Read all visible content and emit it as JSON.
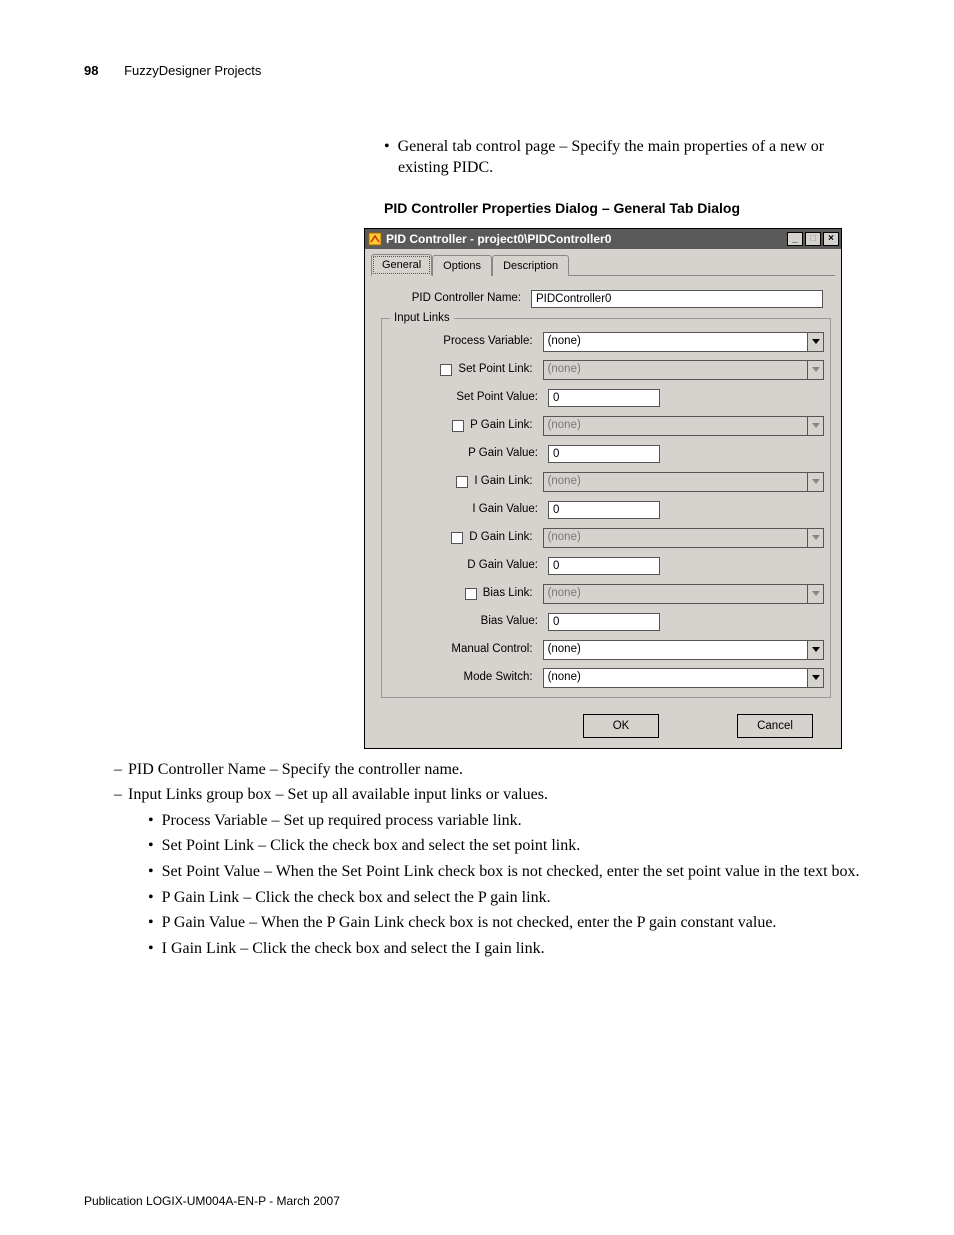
{
  "header": {
    "page_number": "98",
    "chapter": "FuzzyDesigner Projects"
  },
  "intro": "General tab control page – Specify the main properties of a new or existing PIDC.",
  "figure_caption": "PID Controller Properties Dialog – General Tab Dialog",
  "dialog": {
    "title": "PID Controller - project0\\PIDController0",
    "tabs": [
      "General",
      "Options",
      "Description"
    ],
    "name_label": "PID Controller Name:",
    "name_value": "PIDController0",
    "group_title": "Input Links",
    "rows": [
      {
        "label": "Process Variable:",
        "type": "combo",
        "value": "(none)",
        "checkbox": false,
        "enabled": true
      },
      {
        "label": "Set Point Link:",
        "type": "combo",
        "value": "(none)",
        "checkbox": true,
        "enabled": false
      },
      {
        "label": "Set Point Value:",
        "type": "num",
        "value": "0",
        "checkbox": false,
        "enabled": true
      },
      {
        "label": "P Gain Link:",
        "type": "combo",
        "value": "(none)",
        "checkbox": true,
        "enabled": false
      },
      {
        "label": "P Gain Value:",
        "type": "num",
        "value": "0",
        "checkbox": false,
        "enabled": true
      },
      {
        "label": "I Gain Link:",
        "type": "combo",
        "value": "(none)",
        "checkbox": true,
        "enabled": false
      },
      {
        "label": "I Gain Value:",
        "type": "num",
        "value": "0",
        "checkbox": false,
        "enabled": true
      },
      {
        "label": "D Gain Link:",
        "type": "combo",
        "value": "(none)",
        "checkbox": true,
        "enabled": false
      },
      {
        "label": "D Gain Value:",
        "type": "num",
        "value": "0",
        "checkbox": false,
        "enabled": true
      },
      {
        "label": "Bias Link:",
        "type": "combo",
        "value": "(none)",
        "checkbox": true,
        "enabled": false
      },
      {
        "label": "Bias Value:",
        "type": "num",
        "value": "0",
        "checkbox": false,
        "enabled": true
      },
      {
        "label": "Manual Control:",
        "type": "combo",
        "value": "(none)",
        "checkbox": false,
        "enabled": true
      },
      {
        "label": "Mode Switch:",
        "type": "combo",
        "value": "(none)",
        "checkbox": false,
        "enabled": true
      }
    ],
    "buttons": {
      "ok": "OK",
      "cancel": "Cancel"
    }
  },
  "description": {
    "lvl1": [
      "PID Controller Name – Specify the controller name.",
      "Input Links group box – Set up all available input links or values."
    ],
    "lvl2": [
      "Process Variable – Set up required process variable link.",
      "Set Point Link – Click the check box and select the set point link.",
      "Set Point Value – When the Set Point Link check box is not checked, enter the set point value in the text box.",
      "P Gain Link – Click the check box and select the P gain link.",
      "P Gain Value – When the P Gain Link check box is not checked, enter the P gain constant value.",
      "I Gain Link – Click the check box and select the I gain link."
    ]
  },
  "footer": "Publication LOGIX-UM004A-EN-P - March 2007"
}
